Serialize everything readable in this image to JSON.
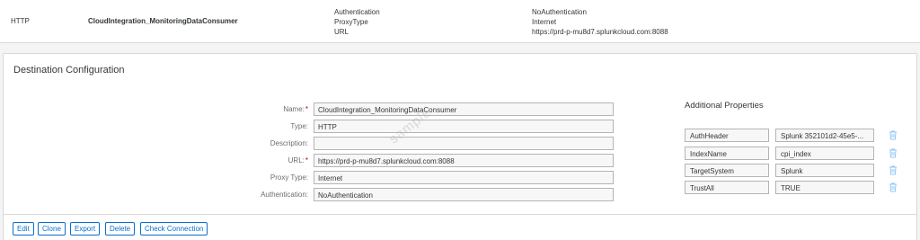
{
  "destination_row": {
    "type": "HTTP",
    "name": "CloudIntegration_MonitoringDataConsumer",
    "props": [
      "Authentication",
      "ProxyType",
      "URL"
    ],
    "values": [
      "NoAuthentication",
      "Internet",
      "https://prd-p-mu8d7.splunkcloud.com:8088"
    ]
  },
  "config": {
    "title": "Destination Configuration",
    "fields": [
      {
        "label": "Name:",
        "required": "*",
        "value": "CloudIntegration_MonitoringDataConsumer"
      },
      {
        "label": "Type:",
        "required": "",
        "value": "HTTP"
      },
      {
        "label": "Description:",
        "required": "",
        "value": ""
      },
      {
        "label": "URL:",
        "required": "*",
        "value": "https://prd-p-mu8d7.splunkcloud.com:8088"
      },
      {
        "label": "Proxy Type:",
        "required": "",
        "value": "Internet"
      },
      {
        "label": "Authentication:",
        "required": "",
        "value": "NoAuthentication"
      }
    ],
    "additional_title": "Additional Properties",
    "additional": [
      {
        "key": "AuthHeader",
        "value": "Splunk 352101d2-45e5-..."
      },
      {
        "key": "IndexName",
        "value": "cpi_index"
      },
      {
        "key": "TargetSystem",
        "value": "Splunk"
      },
      {
        "key": "TrustAll",
        "value": "TRUE"
      }
    ],
    "trash_icon": "trash-icon",
    "watermark": "sample"
  },
  "buttons": {
    "edit": "Edit",
    "clone": "Clone",
    "export": "Export",
    "delete": "Delete",
    "check_connection": "Check Connection"
  },
  "colors": {
    "accent": "#0a6ed1",
    "required": "#bb0000",
    "icon": "#91c8f6"
  }
}
